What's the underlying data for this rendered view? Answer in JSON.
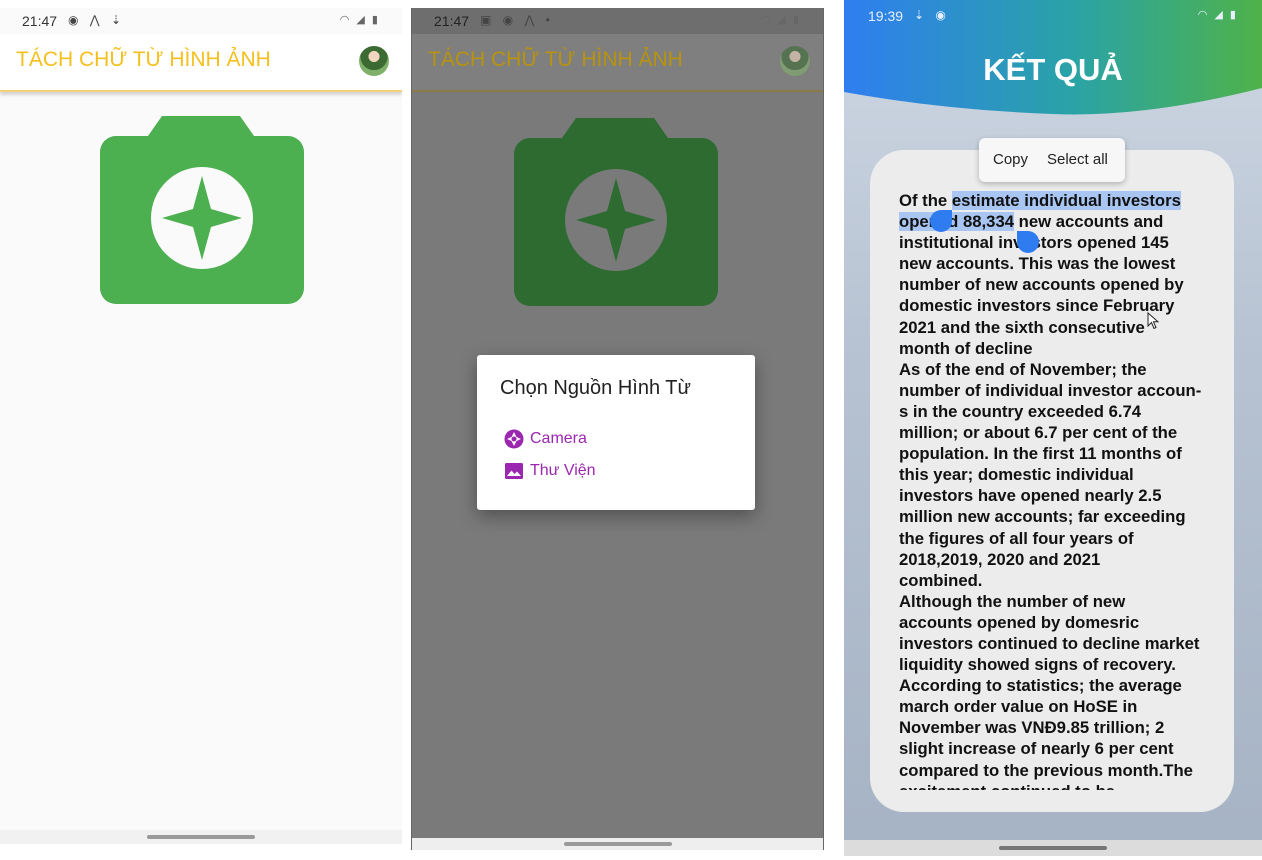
{
  "screen1": {
    "status_time": "21:47",
    "status_icons": "◉ ⋀ ⇣",
    "status_right": "◠ ◢ ▮",
    "app_title": "TÁCH CHỮ TỪ HÌNH ẢNH",
    "main_icon": "camera-icon"
  },
  "screen2": {
    "status_time": "21:47",
    "status_icons": "▣ ◉ ⋀ •",
    "status_right": "◠ ◢ ▮",
    "app_title": "TÁCH CHỮ TỪ HÌNH ẢNH",
    "dialog": {
      "title": "Chọn Nguồn Hình Từ",
      "options": [
        {
          "label": "Camera",
          "icon": "camera-shutter-icon"
        },
        {
          "label": "Thư Viện",
          "icon": "image-gallery-icon"
        }
      ]
    }
  },
  "screen3": {
    "status_time": "19:39",
    "status_icons": "⇣ ◉",
    "status_right": "◠ ◢ ▮",
    "title": "KẾT QUẢ",
    "popup": {
      "copy": "Copy",
      "select_all": "Select all"
    },
    "text_before": "Of the ",
    "text_selected": "estimate individual investors\nopened 88,334",
    "text_after": " new accounts and\ninstitutional investors opened 145\nnew accounts. This was the lowest\nnumber of new accounts opened by\ndomestic investors since February\n2021 and the sixth consecutive\nmonth of decline\nAs of the end of November; the\nnumber of individual investor accoun-\ns in the country exceeded 6.74\nmillion; or about 6.7 per cent of the\npopulation. In the first 11 months of\nthis year; domestic individual\ninvestors have opened nearly 2.5\nmillion new accounts; far exceeding\nthe figures of all four years of\n2018,2019, 2020 and 2021\ncombined.\nAlthough the number of new\naccounts opened by domesric\ninvestors continued to decline market\nliquidity showed signs of recovery.\nAccording to statistics; the average\nmarch order value on HoSE in\nNovember was VNĐ9.85 trillion; 2\nslight increase of nearly 6 per cent\ncompared to the previous month.The\nexcitement continued to be"
  },
  "colors": {
    "accent_yellow": "#f5c01d",
    "camera_green": "#4caf50",
    "dialog_purple": "#9b27b0",
    "selection_blue": "#a9c6f2"
  }
}
